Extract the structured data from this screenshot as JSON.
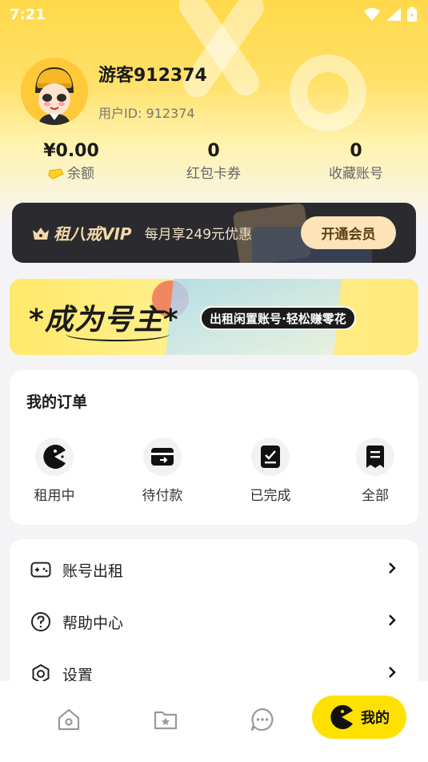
{
  "status": {
    "time": "7:21"
  },
  "profile": {
    "username": "游客912374",
    "user_id": "用户ID: 912374"
  },
  "stats": [
    {
      "value": "¥0.00",
      "label": "余额"
    },
    {
      "value": "0",
      "label": "红包卡券"
    },
    {
      "value": "0",
      "label": "收藏账号"
    }
  ],
  "vip": {
    "logo": "租八戒VIP",
    "description": "每月享249元优惠",
    "button": "开通会员"
  },
  "owner_banner": {
    "title": "*成为号主*",
    "tag": "出租闲置账号·轻松赚零花"
  },
  "orders": {
    "title": "我的订单",
    "items": [
      {
        "label": "租用中",
        "icon": "pacman-icon"
      },
      {
        "label": "待付款",
        "icon": "wallet-icon"
      },
      {
        "label": "已完成",
        "icon": "completed-icon"
      },
      {
        "label": "全部",
        "icon": "receipt-icon"
      }
    ]
  },
  "menu": [
    {
      "label": "账号出租",
      "icon": "gamepad-icon"
    },
    {
      "label": "帮助中心",
      "icon": "help-icon"
    },
    {
      "label": "设置",
      "icon": "settings-icon"
    }
  ],
  "nav": {
    "active_label": "我的"
  },
  "colors": {
    "accent": "#ffe100",
    "vip_bg": "#2b2b2f",
    "vip_button": "#fce3b8"
  }
}
